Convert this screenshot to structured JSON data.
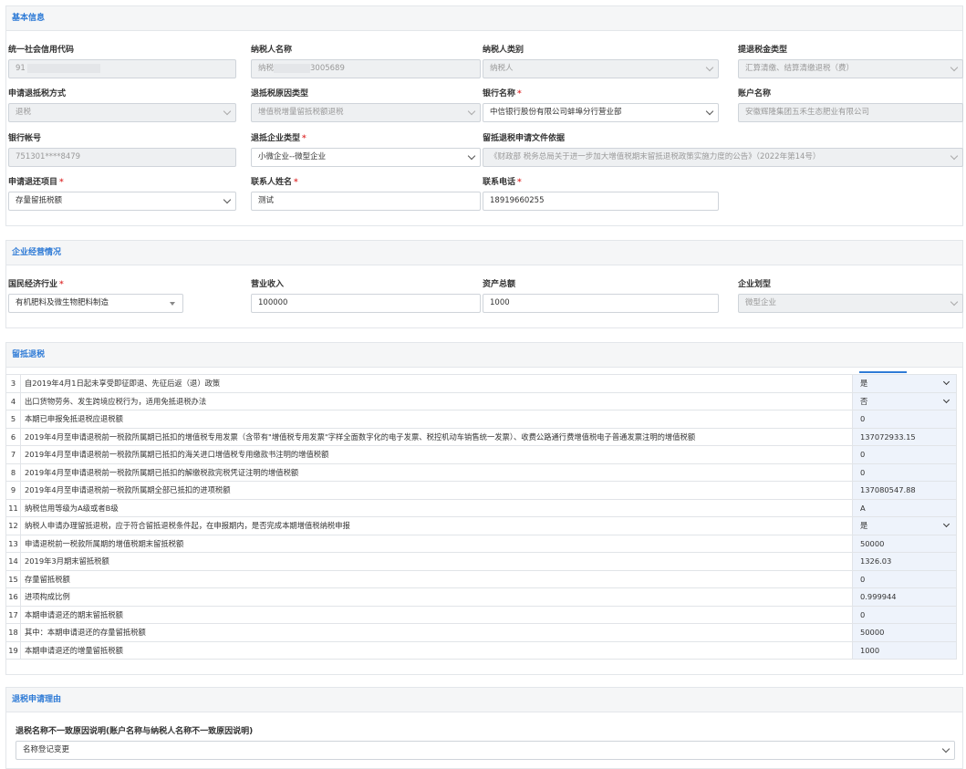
{
  "basic": {
    "title": "基本信息",
    "credit_code_label": "统一社会信用代码",
    "credit_code_value": "91",
    "taxpayer_name_label": "纳税人名称",
    "taxpayer_name_value_prefix": "纳税",
    "taxpayer_name_value_suffix": "3005689",
    "taxpayer_type_label": "纳税人类别",
    "taxpayer_type_value": "纳税人",
    "refund_type_label": "提退税金类型",
    "refund_type_value": "汇算清缴、结算清缴退税（费）",
    "apply_method_label": "申请退抵税方式",
    "apply_method_value": "退税",
    "reason_type_label": "退抵税原因类型",
    "reason_type_value": "增值税增量留抵税额退税",
    "bank_name_label": "银行名称",
    "bank_name_value": "中信银行股份有限公司蚌埠分行营业部",
    "account_name_label": "账户名称",
    "account_name_value": "安徽辉隆集团五禾生态肥业有限公司",
    "bank_account_label": "银行帐号",
    "bank_account_value": "751301****8479",
    "enterprise_type_label": "退抵企业类型",
    "enterprise_type_value": "小微企业--微型企业",
    "basis_label": "留抵退税申请文件依据",
    "basis_value": "《财政部 税务总局关于进一步加大增值税期末留抵退税政策实施力度的公告》（2022年第14号）",
    "refund_item_label": "申请退还项目",
    "refund_item_value": "存量留抵税额",
    "contact_name_label": "联系人姓名",
    "contact_name_value": "测试",
    "phone_label": "联系电话",
    "phone_value": "18919660255",
    "required_mark": "*"
  },
  "business": {
    "title": "企业经营情况",
    "industry_label": "国民经济行业",
    "industry_value": "有机肥料及微生物肥料制造",
    "revenue_label": "营业收入",
    "revenue_value": "100000",
    "assets_label": "资产总额",
    "assets_value": "1000",
    "scale_label": "企业划型",
    "scale_value": "微型企业"
  },
  "refund": {
    "title": "留抵退税",
    "rows": [
      {
        "no": "3",
        "desc": "自2019年4月1日起未享受即征即退、先征后返（退）政策",
        "value": "是",
        "select": true
      },
      {
        "no": "4",
        "desc": "出口货物劳务、发生跨境应税行为，适用免抵退税办法",
        "value": "否",
        "select": true
      },
      {
        "no": "5",
        "desc": "本期已申报免抵退税应退税额",
        "value": "0",
        "select": false
      },
      {
        "no": "6",
        "desc": "2019年4月至申请退税前一税款所属期已抵扣的增值税专用发票（含带有\"增值税专用发票\"字样全面数字化的电子发票、税控机动车销售统一发票）、收费公路通行费增值税电子普通发票注明的增值税额",
        "value": "137072933.15",
        "select": false
      },
      {
        "no": "7",
        "desc": "2019年4月至申请退税前一税款所属期已抵扣的海关进口增值税专用缴款书注明的增值税额",
        "value": "0",
        "select": false
      },
      {
        "no": "8",
        "desc": "2019年4月至申请退税前一税款所属期已抵扣的解缴税款完税凭证注明的增值税额",
        "value": "0",
        "select": false
      },
      {
        "no": "9",
        "desc": "2019年4月至申请退税前一税款所属期全部已抵扣的进项税额",
        "value": "137080547.88",
        "select": false
      },
      {
        "no": "11",
        "desc": "纳税信用等级为A级或者B级",
        "value": "A",
        "select": false
      },
      {
        "no": "12",
        "desc": "纳税人申请办理留抵退税，应于符合留抵退税条件起，在申报期内，是否完成本期增值税纳税申报",
        "value": "是",
        "select": true
      },
      {
        "no": "13",
        "desc": "申请退税前一税款所属期的增值税期末留抵税额",
        "value": "50000",
        "select": false
      },
      {
        "no": "14",
        "desc": "2019年3月期末留抵税额",
        "value": "1326.03",
        "select": false
      },
      {
        "no": "15",
        "desc": "存量留抵税额",
        "value": "0",
        "select": false
      },
      {
        "no": "16",
        "desc": "进项构成比例",
        "value": "0.999944",
        "select": false
      },
      {
        "no": "17",
        "desc": "本期申请退还的期末留抵税额",
        "value": "0",
        "select": false
      },
      {
        "no": "18",
        "desc": "其中：本期申请退还的存量留抵税额",
        "value": "50000",
        "select": false
      },
      {
        "no": "19",
        "desc": "本期申请退还的增量留抵税额",
        "value": "1000",
        "select": false
      }
    ]
  },
  "reason": {
    "title": "退税申请理由",
    "label": "退税名称不一致原因说明(账户名称与纳税人名称不一致原因说明)",
    "value": "名称登记变更"
  },
  "colors": {
    "accent": "#2f7bd6",
    "required": "#e03a3a",
    "value_cell_bg": "#eef3fb"
  }
}
